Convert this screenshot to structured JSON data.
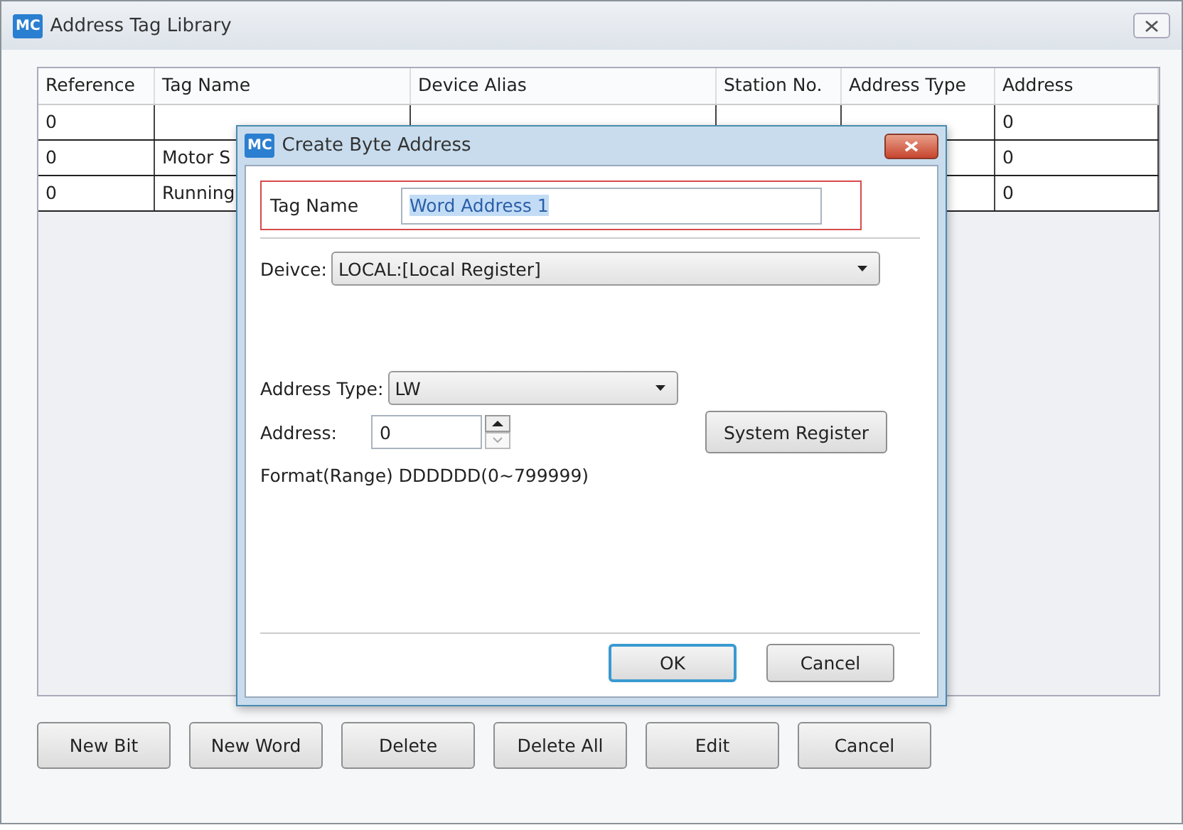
{
  "window": {
    "logo": "MC",
    "title": "Address Tag Library"
  },
  "table": {
    "columns": [
      {
        "label": "Reference"
      },
      {
        "label": "Tag Name"
      },
      {
        "label": "Device Alias"
      },
      {
        "label": "Station No."
      },
      {
        "label": "Address Type"
      },
      {
        "label": "Address"
      }
    ],
    "rows": [
      {
        "reference": "0",
        "address": "0"
      },
      {
        "reference": "0",
        "tag_name": "Motor S",
        "address": "0"
      },
      {
        "reference": "0",
        "tag_name": "Running",
        "address": "0"
      }
    ]
  },
  "buttons": [
    "New Bit",
    "New Word",
    "Delete",
    "Delete All",
    "Edit",
    "Cancel"
  ],
  "dialog": {
    "logo": "MC",
    "title": "Create Byte Address",
    "tag_name": {
      "label": "Tag Name",
      "value": "Word Address 1",
      "value_selected": true,
      "highlighted": true
    },
    "device": {
      "label": "Deivce:",
      "value": "LOCAL:[Local Register]"
    },
    "address_type": {
      "label": "Address Type:",
      "value": "LW"
    },
    "address": {
      "label": "Address:",
      "value": "0"
    },
    "system_register": "System Register",
    "format": "Format(Range) DDDDDD(0~799999)",
    "buttons": [
      {
        "label": "OK",
        "default": true
      },
      {
        "label": "Cancel",
        "default": false
      }
    ]
  }
}
